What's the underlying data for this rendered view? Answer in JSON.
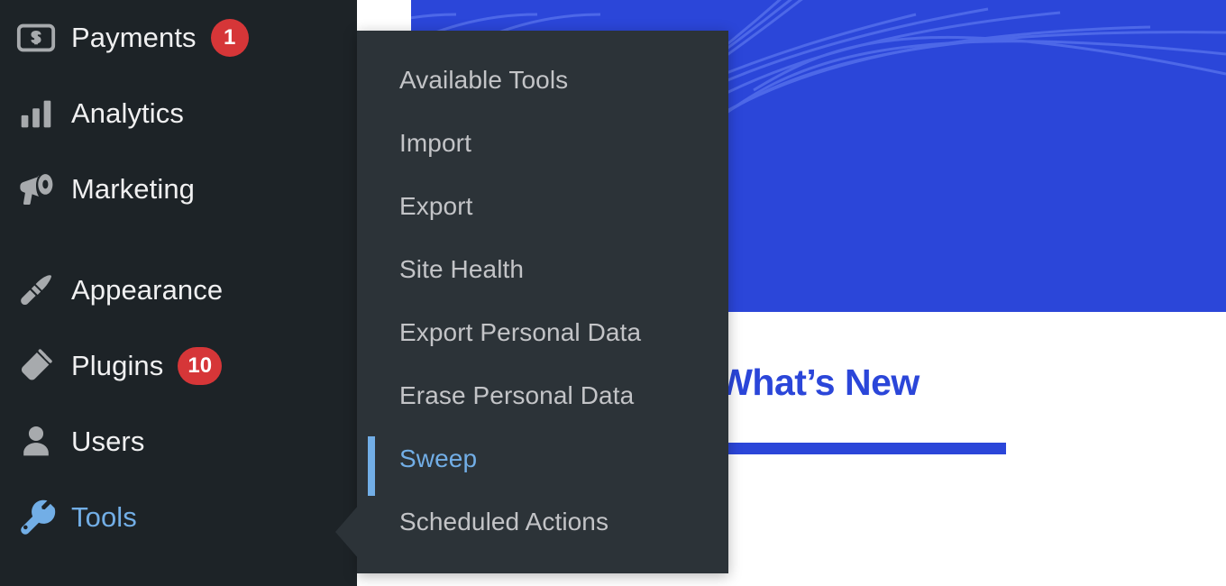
{
  "theme": {
    "sidebar_bg": "#1d2327",
    "submenu_bg": "#2c3338",
    "accent_blue": "#72aee6",
    "badge_red": "#d63638",
    "brand_blue": "#2b46d9",
    "text_light": "#f0f0f1",
    "text_muted": "#c3c4c7"
  },
  "sidebar": {
    "items": [
      {
        "label": "Payments",
        "icon": "payments-icon",
        "badge": "1",
        "active": false
      },
      {
        "label": "Analytics",
        "icon": "analytics-icon",
        "badge": "",
        "active": false
      },
      {
        "label": "Marketing",
        "icon": "megaphone-icon",
        "badge": "",
        "active": false
      },
      {
        "label": "Appearance",
        "icon": "paintbrush-icon",
        "badge": "",
        "active": false
      },
      {
        "label": "Plugins",
        "icon": "plug-icon",
        "badge": "10",
        "active": false
      },
      {
        "label": "Users",
        "icon": "user-icon",
        "badge": "",
        "active": false
      },
      {
        "label": "Tools",
        "icon": "wrench-icon",
        "badge": "",
        "active": true
      }
    ]
  },
  "submenu": {
    "parent": "Tools",
    "items": [
      {
        "label": "Available Tools",
        "active": false
      },
      {
        "label": "Import",
        "active": false
      },
      {
        "label": "Export",
        "active": false
      },
      {
        "label": "Site Health",
        "active": false
      },
      {
        "label": "Export Personal Data",
        "active": false
      },
      {
        "label": "Erase Personal Data",
        "active": false
      },
      {
        "label": "Sweep",
        "active": true
      },
      {
        "label": "Scheduled Actions",
        "active": false
      }
    ]
  },
  "main": {
    "banner": {
      "name": "decorative-arc-pattern"
    },
    "whats_new_title": "What’s New"
  }
}
